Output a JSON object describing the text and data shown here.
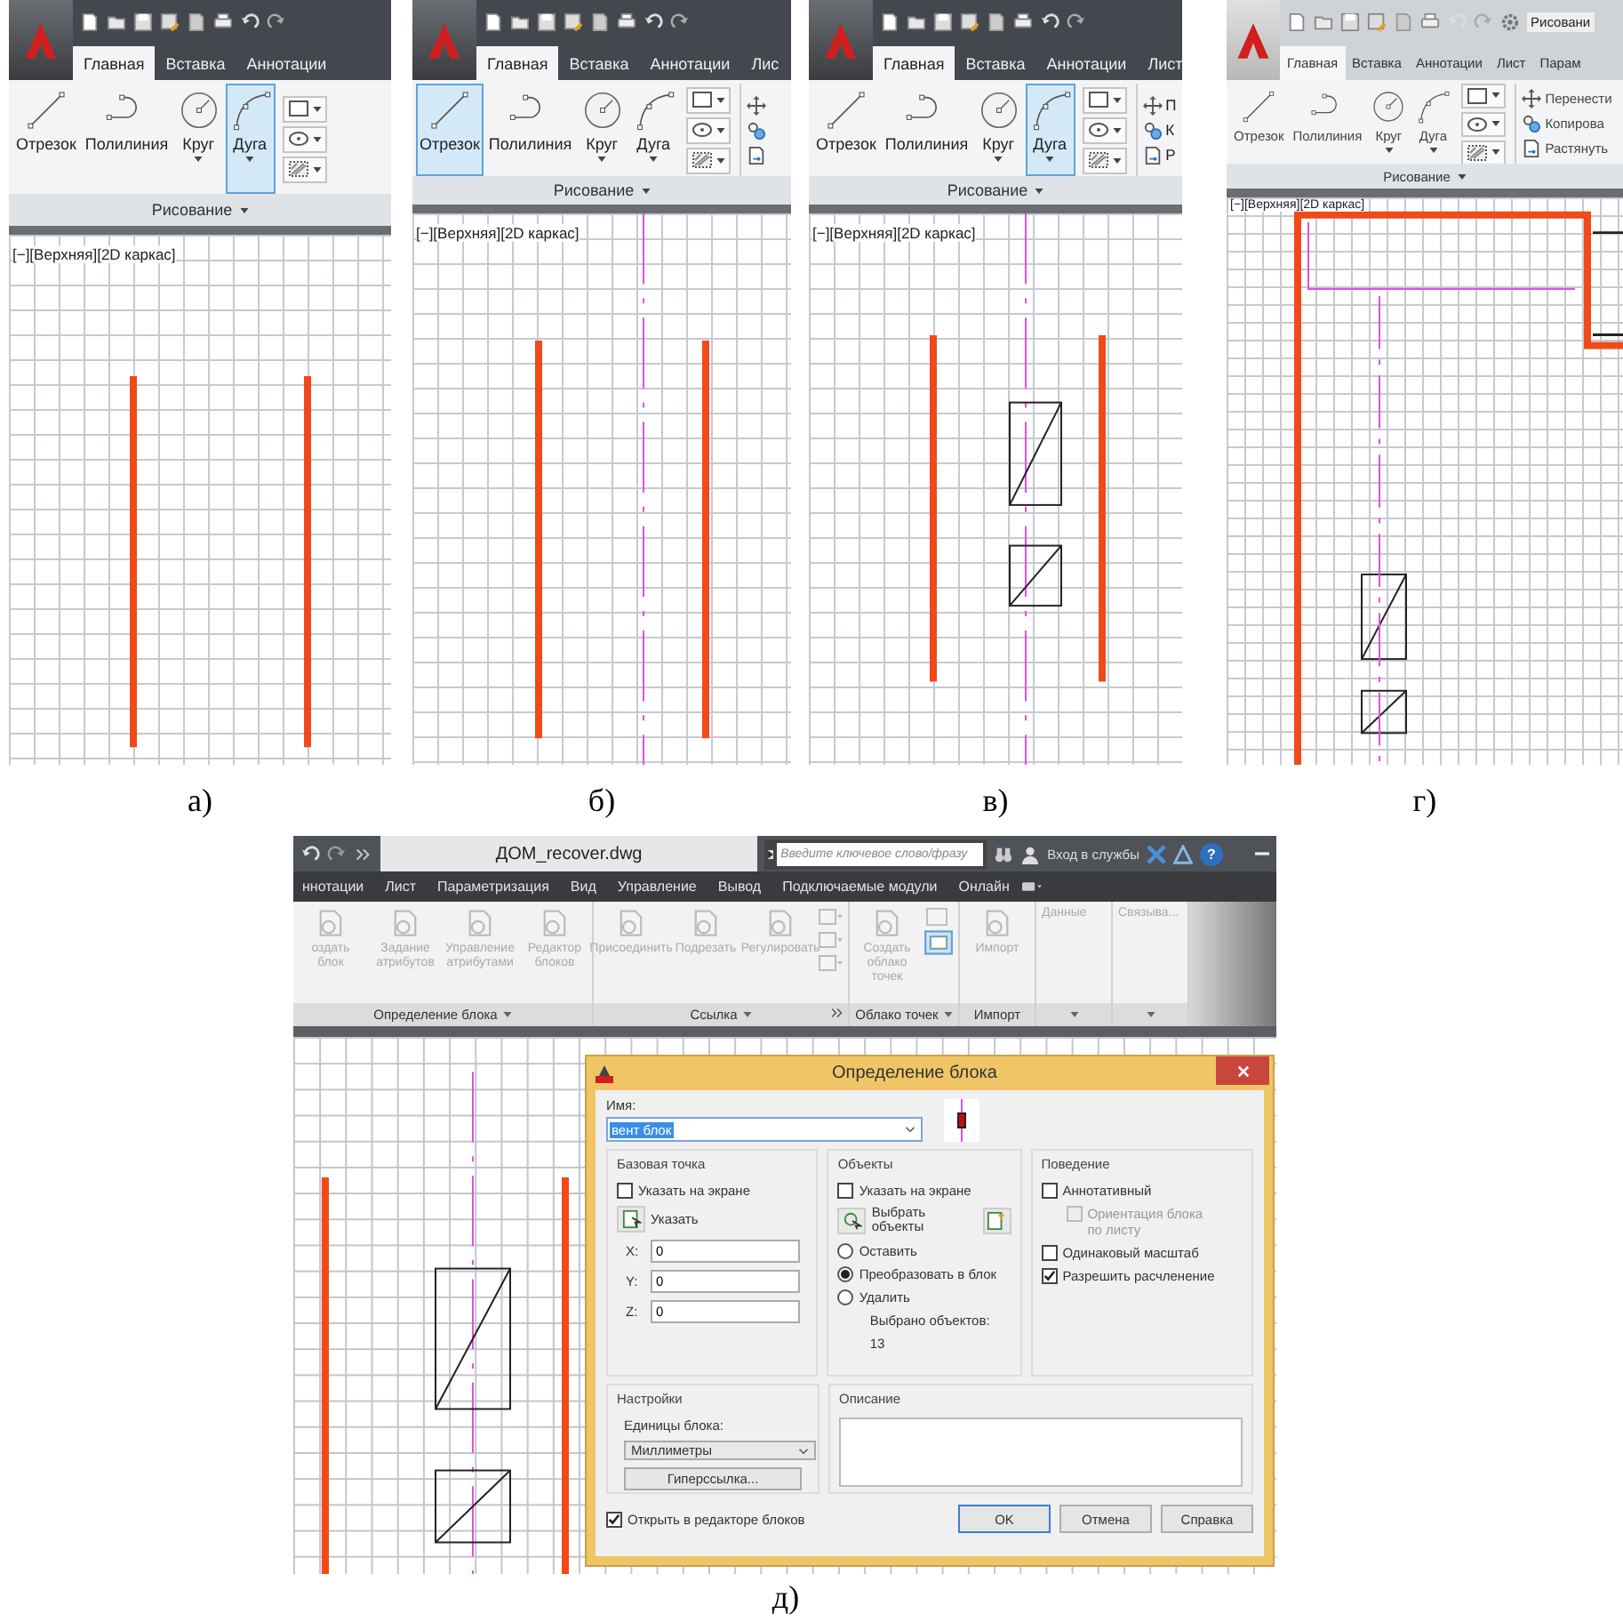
{
  "panels": [
    {
      "caption": "а)",
      "tabs": [
        {
          "label": "Главная",
          "selected": true
        },
        {
          "label": "Вставка",
          "selected": false
        },
        {
          "label": "Аннотации",
          "selected": false
        }
      ],
      "tools": [
        {
          "kind": "line",
          "label": "Отрезок",
          "selected": false,
          "dropdown": false
        },
        {
          "kind": "polyline",
          "label": "Полилиния",
          "selected": false,
          "dropdown": false
        },
        {
          "kind": "circle",
          "label": "Круг",
          "selected": false,
          "dropdown": true
        },
        {
          "kind": "arc",
          "label": "Дуга",
          "selected": true,
          "dropdown": true
        }
      ],
      "group_label": "Рисование",
      "viewport": {
        "label": "[−][Верхняя][2D каркас]"
      }
    },
    {
      "caption": "б)",
      "tabs": [
        {
          "label": "Главная",
          "selected": true
        },
        {
          "label": "Вставка",
          "selected": false
        },
        {
          "label": "Аннотации",
          "selected": false
        },
        {
          "label": "Лис",
          "selected": false
        }
      ],
      "tools": [
        {
          "kind": "line",
          "label": "Отрезок",
          "selected": true,
          "dropdown": false
        },
        {
          "kind": "polyline",
          "label": "Полилиния",
          "selected": false,
          "dropdown": false
        },
        {
          "kind": "circle",
          "label": "Круг",
          "selected": false,
          "dropdown": true
        },
        {
          "kind": "arc",
          "label": "Дуга",
          "selected": false,
          "dropdown": true
        }
      ],
      "modify_tools": [
        {
          "kind": "move"
        },
        {
          "kind": "copy"
        },
        {
          "kind": "stretch"
        }
      ],
      "group_label": "Рисование",
      "viewport": {
        "label": "[−][Верхняя][2D каркас]"
      }
    },
    {
      "caption": "в)",
      "tabs": [
        {
          "label": "Главная",
          "selected": true
        },
        {
          "label": "Вставка",
          "selected": false
        },
        {
          "label": "Аннотации",
          "selected": false
        },
        {
          "label": "Лист",
          "selected": false
        }
      ],
      "tools": [
        {
          "kind": "line",
          "label": "Отрезок",
          "selected": false,
          "dropdown": false
        },
        {
          "kind": "polyline",
          "label": "Полилиния",
          "selected": false,
          "dropdown": false
        },
        {
          "kind": "circle",
          "label": "Круг",
          "selected": false,
          "dropdown": true
        },
        {
          "kind": "arc",
          "label": "Дуга",
          "selected": true,
          "dropdown": true
        }
      ],
      "modify_tools": [
        {
          "kind": "move",
          "label": "П"
        },
        {
          "kind": "copy",
          "label": "К"
        },
        {
          "kind": "stretch",
          "label": "Р"
        }
      ],
      "group_label": "Рисование",
      "viewport": {
        "label": "[−][Верхняя][2D каркас]"
      }
    },
    {
      "caption": "г)",
      "workspace": "Рисовани",
      "tabs": [
        {
          "label": "Главная",
          "selected": true
        },
        {
          "label": "Вставка",
          "selected": false
        },
        {
          "label": "Аннотации",
          "selected": false
        },
        {
          "label": "Лист",
          "selected": false
        },
        {
          "label": "Парам",
          "selected": false
        }
      ],
      "tools": [
        {
          "kind": "line",
          "label": "Отрезок",
          "selected": false,
          "dropdown": false
        },
        {
          "kind": "polyline",
          "label": "Полилиния",
          "selected": false,
          "dropdown": false
        },
        {
          "kind": "circle",
          "label": "Круг",
          "selected": false,
          "dropdown": true
        },
        {
          "kind": "arc",
          "label": "Дуга",
          "selected": false,
          "dropdown": true
        }
      ],
      "modify_tools": [
        {
          "kind": "move",
          "label": "Перенести"
        },
        {
          "kind": "copy",
          "label": "Копирова"
        },
        {
          "kind": "stretch",
          "label": "Растянуть"
        }
      ],
      "group_label": "Рисование",
      "viewport": {
        "label": "[−][Верхняя][2D каркас]"
      }
    }
  ],
  "app_window": {
    "caption": "д)",
    "title": "ДОМ_recover.dwg",
    "search": {
      "placeholder": "Введите ключевое слово/фразу"
    },
    "sign_in": "Вход в службы",
    "help": "?",
    "tabs": [
      {
        "label": "ннотации",
        "selected": false
      },
      {
        "label": "Лист",
        "selected": false
      },
      {
        "label": "Параметризация",
        "selected": false
      },
      {
        "label": "Вид",
        "selected": false
      },
      {
        "label": "Управление",
        "selected": false
      },
      {
        "label": "Вывод",
        "selected": false
      },
      {
        "label": "Подключаемые модули",
        "selected": false
      },
      {
        "label": "Онлайн",
        "selected": false
      }
    ],
    "ribbon_groups": [
      {
        "label": "Определение блока",
        "menu": true,
        "tools": [
          {
            "label": "оздать блок",
            "disabled": true
          },
          {
            "label": "Задание атрибутов",
            "disabled": true
          },
          {
            "label": "Управление атрибутами",
            "disabled": true
          },
          {
            "label": "Редактор блоков",
            "disabled": true
          }
        ]
      },
      {
        "label": "Ссылка",
        "menu": true,
        "tools": [
          {
            "label": "Присоединить",
            "disabled": true
          },
          {
            "label": "Подрезать",
            "disabled": true
          },
          {
            "label": "Регулировать",
            "disabled": true
          }
        ]
      },
      {
        "label": "Облако точек",
        "menu": true,
        "tools": [
          {
            "label": "Создать облако точек",
            "disabled": true
          }
        ]
      },
      {
        "label": "Импорт",
        "menu": false,
        "tools": [
          {
            "label": "Импорт",
            "disabled": true
          }
        ]
      },
      {
        "title": "Данные",
        "menu": true
      },
      {
        "title": "Связыва...",
        "menu": true
      }
    ],
    "dialog": {
      "title": "Определение блока",
      "name": {
        "label": "Имя:",
        "value": "вент блок"
      },
      "base_point": {
        "title": "Базовая точка",
        "pick_on_screen": {
          "label": "Указать на экране",
          "checked": false
        },
        "pick_button": "Указать",
        "coords": [
          {
            "label": "X:",
            "value": "0"
          },
          {
            "label": "Y:",
            "value": "0"
          },
          {
            "label": "Z:",
            "value": "0"
          }
        ]
      },
      "objects": {
        "title": "Объекты",
        "pick_on_screen": {
          "label": "Указать на экране",
          "checked": false
        },
        "select_button": "Выбрать объекты",
        "options": [
          {
            "label": "Оставить",
            "selected": false
          },
          {
            "label": "Преобразовать в блок",
            "selected": true
          },
          {
            "label": "Удалить",
            "selected": false
          }
        ],
        "count_label": "Выбрано объектов:",
        "count": "13"
      },
      "behavior": {
        "title": "Поведение",
        "options": [
          {
            "label": "Аннотативный",
            "checked": false,
            "disabled": false,
            "children": [
              {
                "label": "Ориентация блока по листу",
                "checked": false,
                "disabled": true
              }
            ]
          },
          {
            "label": "Одинаковый масштаб",
            "checked": false,
            "disabled": false
          },
          {
            "label": "Разрешить расчленение",
            "checked": true,
            "disabled": false
          }
        ]
      },
      "settings": {
        "title": "Настройки",
        "units_label": "Единицы блока:",
        "units": "Миллиметры",
        "hyperlink_button": "Гиперссылка..."
      },
      "description": {
        "title": "Описание"
      },
      "open_in_editor": {
        "label": "Открыть в редакторе блоков",
        "checked": true
      },
      "buttons": [
        "OK",
        "Отмена",
        "Справка"
      ]
    }
  }
}
